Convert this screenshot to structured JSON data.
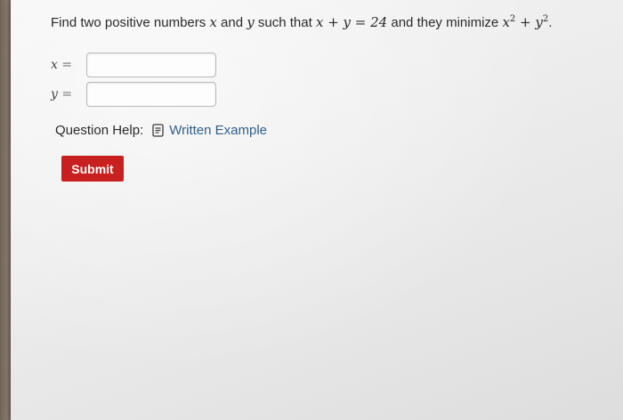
{
  "question": {
    "prefix": "Find two positive numbers ",
    "var_x": "x",
    "and": " and ",
    "var_y": "y",
    "such_that": " such that ",
    "constraint": "x + y = 24",
    "mid": " and they minimize ",
    "objective_x": "x",
    "objective_plus": " + ",
    "objective_y": "y",
    "exponent": "2",
    "period": "."
  },
  "answers": {
    "x_label": "x",
    "y_label": "y",
    "equals": "=",
    "x_value": "",
    "y_value": ""
  },
  "help": {
    "label": "Question Help:",
    "link_text": "Written Example",
    "icon": "document-icon"
  },
  "submit": {
    "label": "Submit",
    "color": "#c8201f"
  }
}
